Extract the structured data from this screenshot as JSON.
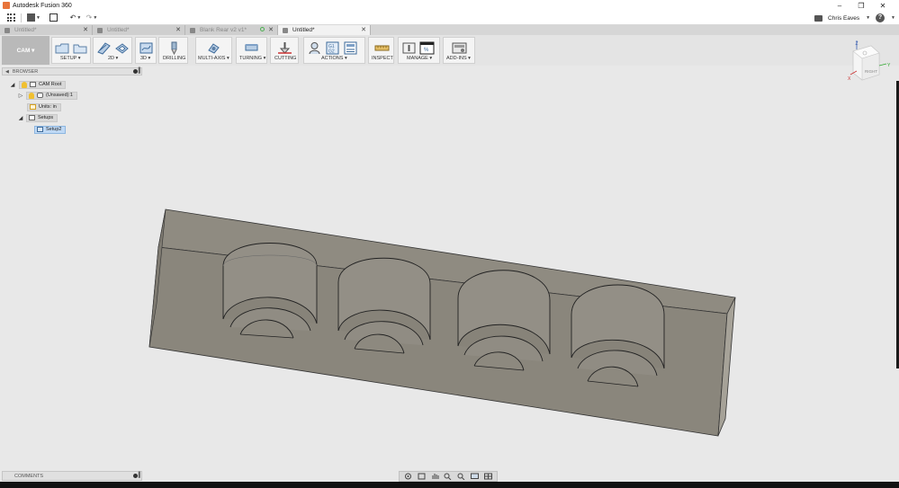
{
  "window": {
    "title": "Autodesk Fusion 360",
    "controls": [
      "–",
      "❐",
      "✕"
    ]
  },
  "quick_access": {
    "user_name": "Chris Eaves",
    "help_label": "?"
  },
  "tabs": [
    {
      "label": "Untitled*",
      "active": false
    },
    {
      "label": "Untitled*",
      "active": false
    },
    {
      "label": "Blank Rear v2 v1*",
      "active": false
    },
    {
      "label": "Untitled*",
      "active": true
    }
  ],
  "toolbar": {
    "workspace_label": "CAM ▾",
    "groups": [
      {
        "label": "SETUP ▾"
      },
      {
        "label": "2D ▾"
      },
      {
        "label": "3D ▾"
      },
      {
        "label": "DRILLING"
      },
      {
        "label": "MULTI-AXIS ▾"
      },
      {
        "label": "TURNING ▾"
      },
      {
        "label": "CUTTING"
      },
      {
        "label": "ACTIONS ▾"
      },
      {
        "label": "INSPECT"
      },
      {
        "label": "MANAGE ▾"
      },
      {
        "label": "ADD-INS ▾"
      }
    ]
  },
  "browser": {
    "title": "BROWSER",
    "items": [
      {
        "label": "CAM Root"
      },
      {
        "label": "(Unsaved):1"
      },
      {
        "label": "Units: in"
      },
      {
        "label": "Setups"
      },
      {
        "label": "Setup2"
      }
    ]
  },
  "viewcube": {
    "face_label": "RIGHT",
    "axis_labels": {
      "z": "Z",
      "x": "X",
      "y": "Y"
    }
  },
  "comments": {
    "title": "COMMENTS"
  },
  "colors": {
    "model_top": "#8e8a80",
    "model_front": "#8a867c",
    "model_side": "#a7a39a",
    "selected_node": "#bfd9f5"
  }
}
